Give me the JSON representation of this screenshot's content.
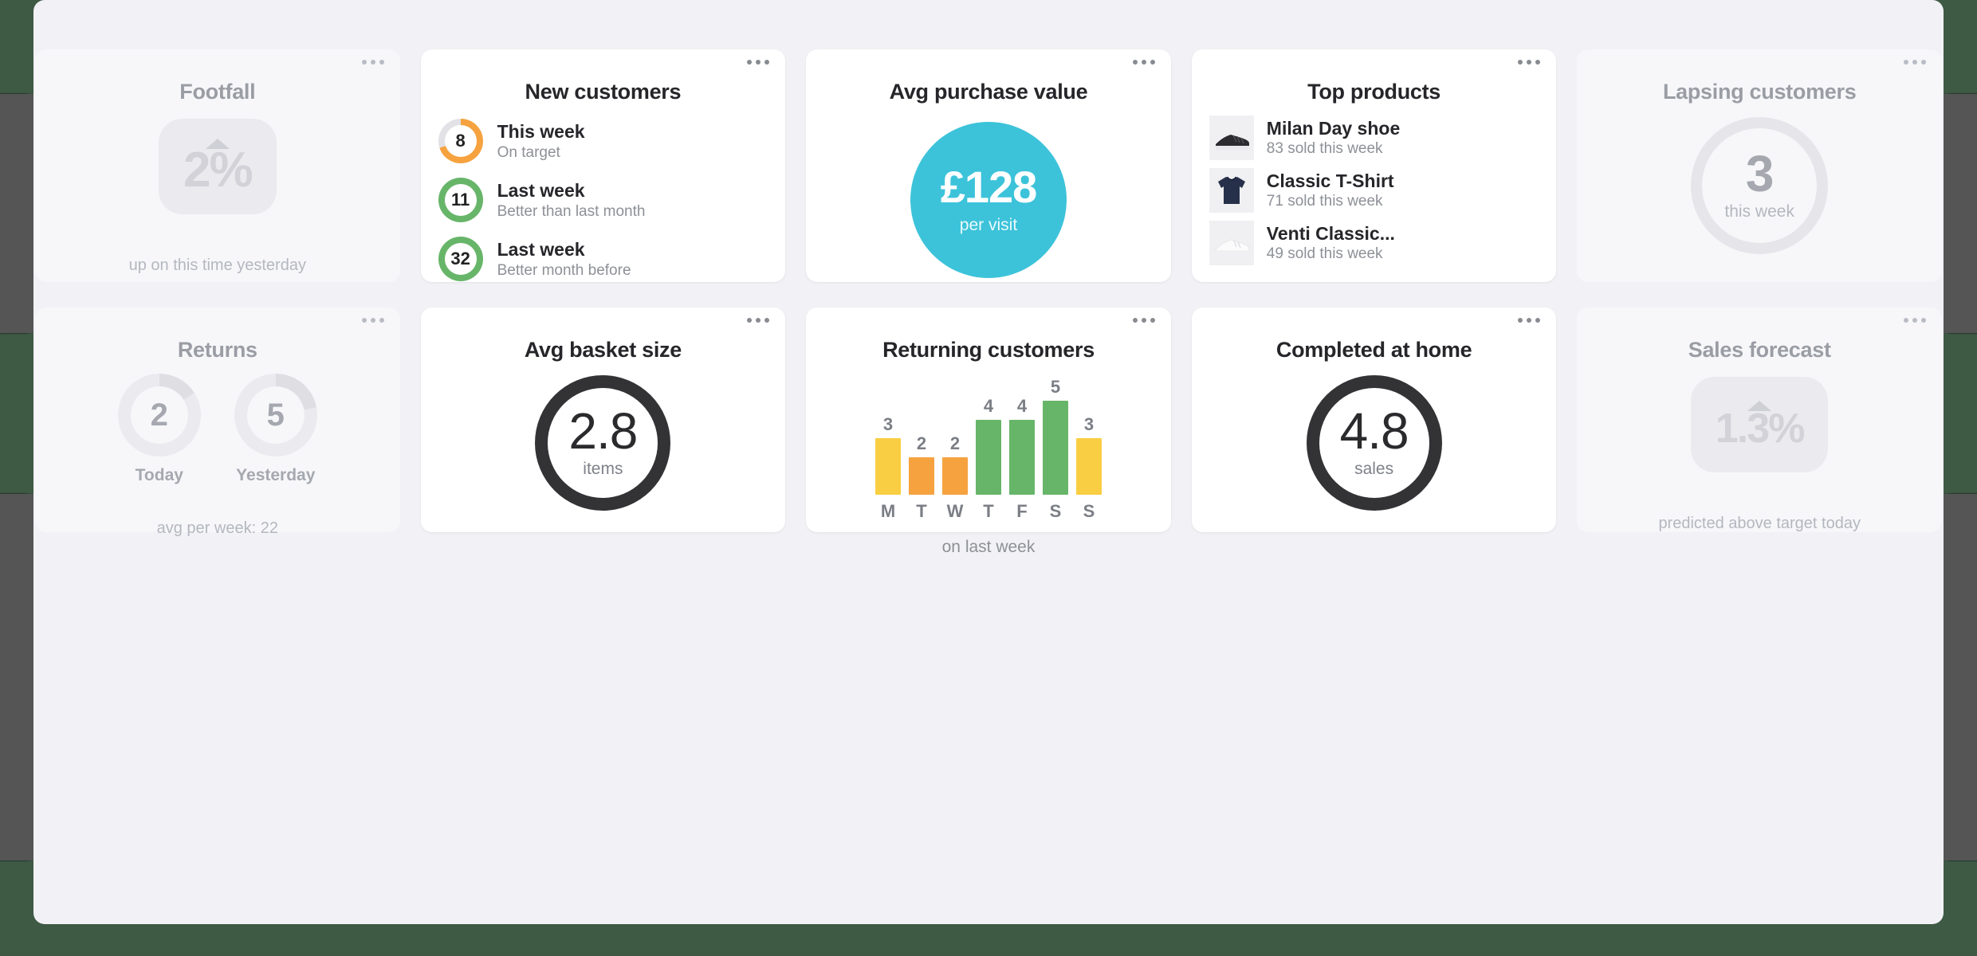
{
  "theme": {
    "page_bg": "#3e5a45",
    "panel_bg": "#f2f2f6",
    "card_bg": "#ffffff",
    "ghost_card_bg": "#f7f7fa",
    "accent_cyan": "#3cc3da",
    "accent_green": "#67b569",
    "accent_orange": "#f5a23f",
    "accent_yellow": "#f9ce42",
    "ring_track": "#e2e2e6",
    "dark_ring": "#333336",
    "muted_text": "#8d9096",
    "ghost_text": "#a5a8af"
  },
  "menu_icon": "ellipsis-icon",
  "cards": {
    "footfall": {
      "title": "Footfall",
      "arrow_icon": "arrow-up-icon",
      "value": "2%",
      "caption": "up on this time yesterday"
    },
    "new_customers": {
      "title": "New customers",
      "rows": [
        {
          "count": "8",
          "ring_color": "#f5a23f",
          "ring_pct": 70,
          "label": "This week",
          "sublabel": "On target"
        },
        {
          "count": "11",
          "ring_color": "#67b569",
          "ring_pct": 100,
          "label": "Last week",
          "sublabel": "Better than last month"
        },
        {
          "count": "32",
          "ring_color": "#67b569",
          "ring_pct": 100,
          "label": "Last week",
          "sublabel": "Better month before"
        }
      ]
    },
    "avg_purchase_value": {
      "title": "Avg purchase value",
      "value": "£128",
      "label": "per visit"
    },
    "top_products": {
      "title": "Top products",
      "items": [
        {
          "name": "Milan Day shoe",
          "sold": "83 sold this week",
          "thumb_icon": "black-sneaker-icon"
        },
        {
          "name": "Classic T-Shirt",
          "sold": "71 sold this week",
          "thumb_icon": "navy-tshirt-icon"
        },
        {
          "name": "Venti Classic...",
          "sold": "49 sold this week",
          "thumb_icon": "white-sneaker-icon"
        }
      ]
    },
    "lapsing_customers": {
      "title": "Lapsing customers",
      "value": "3",
      "label": "this week"
    },
    "returns": {
      "title": "Returns",
      "dials": [
        {
          "value": "2",
          "label": "Today",
          "pct": 16
        },
        {
          "value": "5",
          "label": "Yesterday",
          "pct": 22
        }
      ],
      "footer": "avg per week: 22"
    },
    "avg_basket_size": {
      "title": "Avg basket size",
      "value": "2.8",
      "label": "items"
    },
    "returning_customers": {
      "title": "Returning customers",
      "footer": "on last week"
    },
    "completed_at_home": {
      "title": "Completed at home",
      "value": "4.8",
      "label": "sales"
    },
    "sales_forecast": {
      "title": "Sales forecast",
      "arrow_icon": "arrow-up-icon",
      "value": "1.3%",
      "caption": "predicted above target today"
    }
  },
  "chart_data": {
    "type": "bar",
    "title": "Returning customers",
    "categories": [
      "M",
      "T",
      "W",
      "T",
      "F",
      "S",
      "S"
    ],
    "values": [
      3,
      2,
      2,
      4,
      4,
      5,
      3
    ],
    "bar_colors": [
      "#f9ce42",
      "#f5a23f",
      "#f5a23f",
      "#67b569",
      "#67b569",
      "#67b569",
      "#f9ce42"
    ],
    "xlabel": "",
    "ylabel": "",
    "ylim": [
      0,
      5
    ],
    "grid": false,
    "legend": "none",
    "annotation": "on last week"
  }
}
